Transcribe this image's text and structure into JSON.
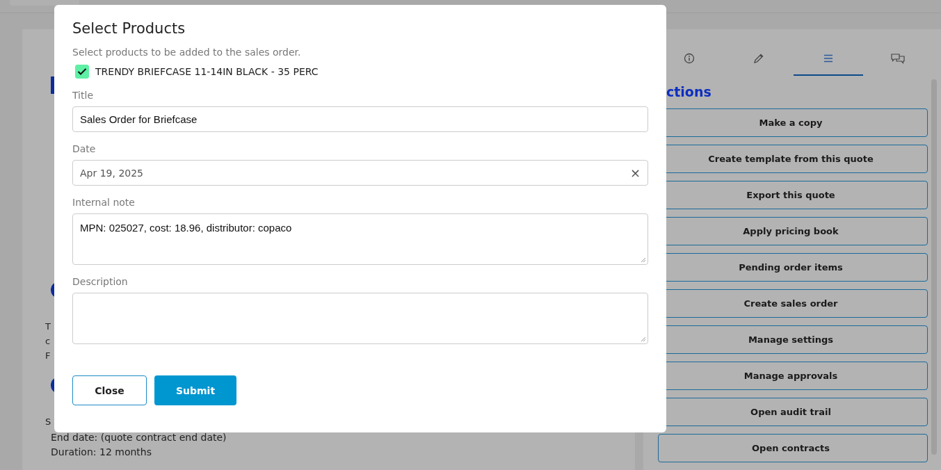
{
  "background": {
    "fragments": [
      "T",
      "c",
      "F",
      "S"
    ],
    "lines": [
      "End date: (quote contract end date)",
      "Duration: 12 months"
    ]
  },
  "side_panel": {
    "tabs": [
      {
        "selected": false
      },
      {
        "selected": false
      },
      {
        "selected": true
      },
      {
        "selected": false
      }
    ],
    "heading": "ctions",
    "actions": [
      "Make a copy",
      "Create template from this quote",
      "Export this quote",
      "Apply pricing book",
      "Pending order items",
      "Create sales order",
      "Manage settings",
      "Manage approvals",
      "Open audit trail",
      "Open contracts"
    ]
  },
  "dialog": {
    "title": "Select Products",
    "subtitle": "Select products to be added to the sales order.",
    "products": [
      {
        "label": "TRENDY BRIEFCASE 11-14IN BLACK - 35 PERC",
        "checked": true
      }
    ],
    "fields": [
      {
        "kind": "input",
        "label": "Title",
        "value": "Sales Order for Briefcase"
      },
      {
        "kind": "date",
        "label": "Date",
        "value": "Apr 19, 2025",
        "clear": "×"
      },
      {
        "kind": "textarea",
        "label": "Internal note",
        "value": "MPN: 025027, cost: 18.96, distributor: copaco"
      },
      {
        "kind": "textarea",
        "label": "Description"
      }
    ],
    "buttons": [
      {
        "label": "Close",
        "kind": "secondary"
      },
      {
        "label": "Submit",
        "kind": "primary"
      }
    ]
  }
}
